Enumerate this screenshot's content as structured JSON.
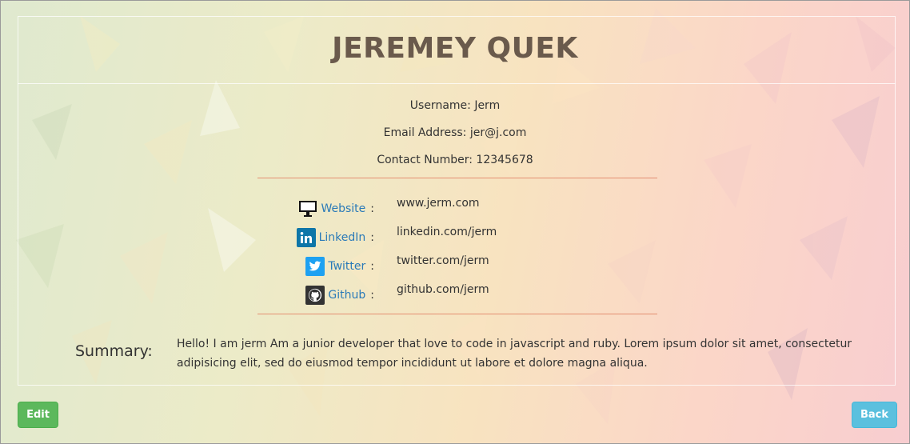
{
  "profile": {
    "name": "JEREMEY QUEK",
    "username_line": "Username: Jerm",
    "email_line": "Email Address: jer@j.com",
    "contact_line": "Contact Number: 12345678"
  },
  "socials": [
    {
      "label": "Website",
      "colon": ":",
      "value": "www.jerm.com",
      "icon": "monitor-icon",
      "color": "#222222"
    },
    {
      "label": "LinkedIn",
      "colon": ":",
      "value": "linkedin.com/jerm",
      "icon": "linkedin-icon",
      "color": "#0e76a8"
    },
    {
      "label": "Twitter",
      "colon": ":",
      "value": "twitter.com/jerm",
      "icon": "twitter-icon",
      "color": "#1da1f2"
    },
    {
      "label": "Github",
      "colon": ":",
      "value": "github.com/jerm",
      "icon": "github-icon",
      "color": "#333333"
    }
  ],
  "summary": {
    "label": "Summary:",
    "text": "Hello! I am jerm Am a junior developer that love to code in javascript and ruby. Lorem ipsum dolor sit amet, consectetur adipisicing elit, sed do eiusmod tempor incididunt ut labore et dolore magna aliqua."
  },
  "buttons": {
    "edit": "Edit",
    "back": "Back"
  },
  "colors": {
    "link": "#2a7ab8",
    "divider": "#e48f72",
    "edit_button": "#5cb85c",
    "back_button": "#5bc0de"
  }
}
